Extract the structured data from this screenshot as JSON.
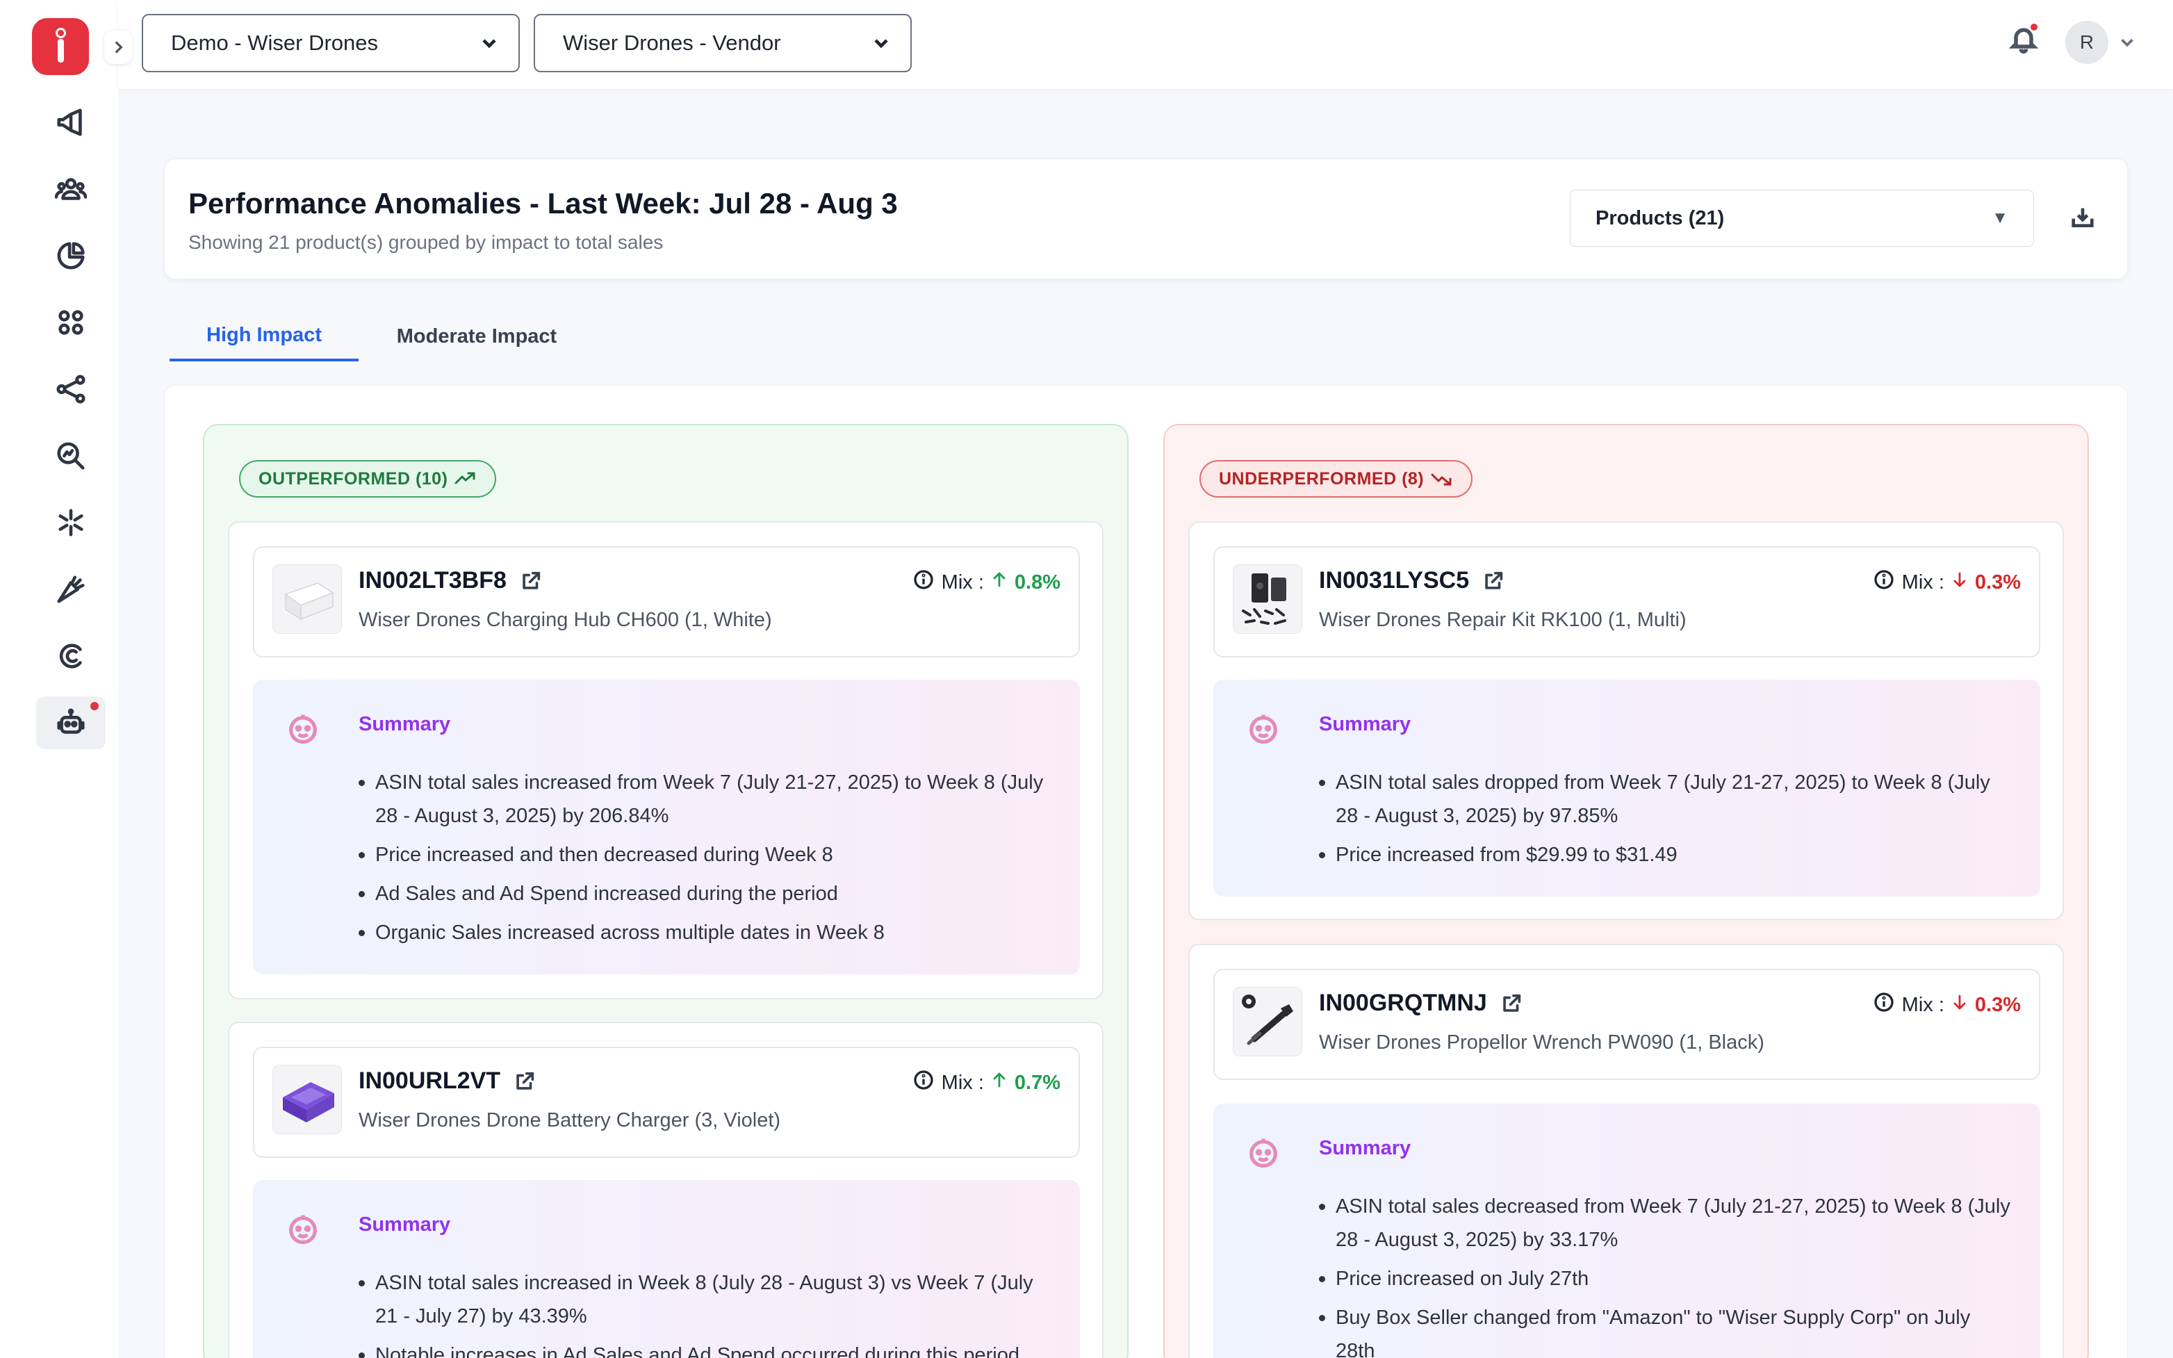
{
  "topbar": {
    "account_select": "Demo - Wiser Drones",
    "vendor_select": "Wiser Drones - Vendor",
    "avatar_initial": "R"
  },
  "sidebar": {
    "items": [
      {
        "name": "megaphone-icon"
      },
      {
        "name": "users-icon"
      },
      {
        "name": "pie-chart-icon"
      },
      {
        "name": "apps-grid-icon"
      },
      {
        "name": "share-icon"
      },
      {
        "name": "search-analytics-icon"
      },
      {
        "name": "spark-icon"
      },
      {
        "name": "carrot-icon"
      },
      {
        "name": "c-logo-icon"
      },
      {
        "name": "robot-icon",
        "active": true
      }
    ]
  },
  "header": {
    "title": "Performance Anomalies - Last Week: Jul 28 - Aug 3",
    "subtitle": "Showing 21 product(s) grouped by impact to total sales",
    "products_select": "Products (21)"
  },
  "tabs": [
    {
      "label": "High Impact",
      "active": true
    },
    {
      "label": "Moderate Impact",
      "active": false
    }
  ],
  "outperformed": {
    "label": "OUTPERFORMED (10)",
    "color": "#1f7a3e",
    "products": [
      {
        "asin": "IN002LT3BF8",
        "name": "Wiser Drones Charging Hub CH600 (1, White)",
        "mix_label": "Mix :",
        "mix_value": "0.8%",
        "direction": "up",
        "summary_title": "Summary",
        "bullets": [
          "ASIN total sales increased from Week 7 (July 21-27, 2025) to Week 8 (July 28 - August 3, 2025) by 206.84%",
          "Price increased and then decreased during Week 8",
          "Ad Sales and Ad Spend increased during the period",
          "Organic Sales increased across multiple dates in Week 8"
        ]
      },
      {
        "asin": "IN00URL2VT",
        "name": "Wiser Drones Drone Battery Charger (3, Violet)",
        "mix_label": "Mix :",
        "mix_value": "0.7%",
        "direction": "up",
        "summary_title": "Summary",
        "bullets": [
          "ASIN total sales increased in Week 8 (July 28 - August 3) vs Week 7 (July 21 - July 27) by 43.39%",
          "Notable increases in Ad Sales and Ad Spend occurred during this period"
        ]
      }
    ]
  },
  "underperformed": {
    "label": "UNDERPERFORMED (8)",
    "color": "#b42323",
    "products": [
      {
        "asin": "IN0031LYSC5",
        "name": "Wiser Drones Repair Kit RK100 (1, Multi)",
        "mix_label": "Mix :",
        "mix_value": "0.3%",
        "direction": "down",
        "summary_title": "Summary",
        "bullets": [
          "ASIN total sales dropped from Week 7 (July 21-27, 2025) to Week 8 (July 28 - August 3, 2025) by 97.85%",
          "Price increased from $29.99 to $31.49"
        ]
      },
      {
        "asin": "IN00GRQTMNJ",
        "name": "Wiser Drones Propellor Wrench PW090 (1, Black)",
        "mix_label": "Mix :",
        "mix_value": "0.3%",
        "direction": "down",
        "summary_title": "Summary",
        "bullets": [
          "ASIN total sales decreased from Week 7 (July 21-27, 2025) to Week 8 (July 28 - August 3, 2025) by 33.17%",
          "Price increased on July 27th",
          "Buy Box Seller changed from \"Amazon\" to \"Wiser Supply Corp\" on July 28th"
        ]
      }
    ]
  },
  "colors": {
    "accent_blue": "#2563eb",
    "brand_red": "#e5323e",
    "up_green": "#1e9e4d",
    "down_red": "#d62828",
    "summary_purple": "#9333ea"
  }
}
